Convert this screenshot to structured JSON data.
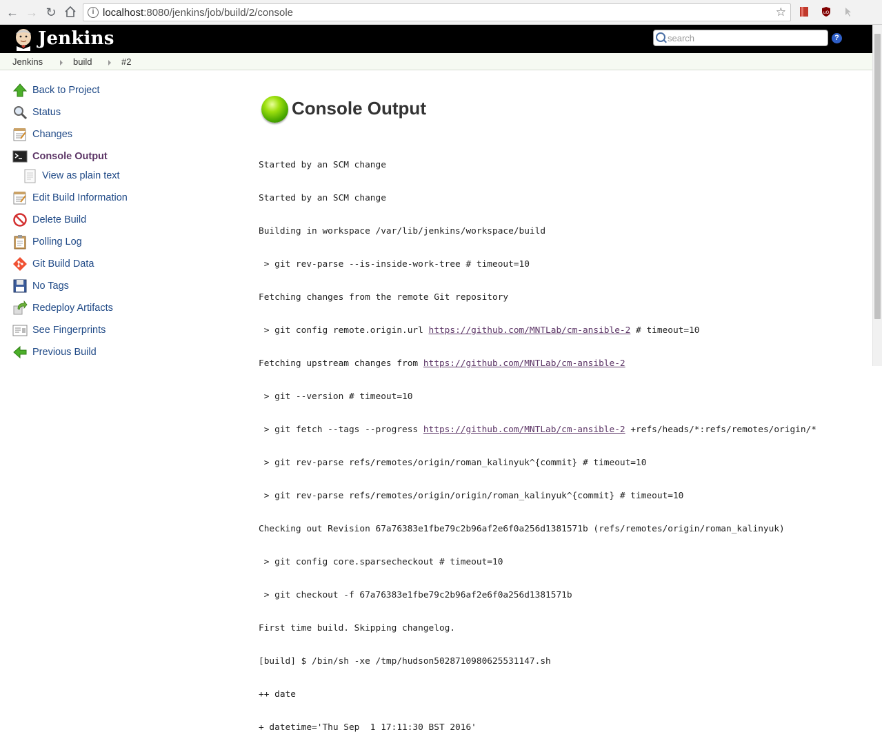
{
  "browser": {
    "url_host": "localhost",
    "url_path": ":8080/jenkins/job/build/2/console"
  },
  "header": {
    "logo_text": "Jenkins",
    "search_placeholder": "search"
  },
  "breadcrumb": [
    "Jenkins",
    "build",
    "#2"
  ],
  "sidebar": {
    "items": [
      {
        "label": "Back to Project",
        "icon": "up-arrow-icon"
      },
      {
        "label": "Status",
        "icon": "magnifier-icon"
      },
      {
        "label": "Changes",
        "icon": "notepad-icon"
      },
      {
        "label": "Console Output",
        "icon": "terminal-icon",
        "active": true
      },
      {
        "label": "View as plain text",
        "icon": "document-icon",
        "sub": true
      },
      {
        "label": "Edit Build Information",
        "icon": "notepad-icon"
      },
      {
        "label": "Delete Build",
        "icon": "no-entry-icon"
      },
      {
        "label": "Polling Log",
        "icon": "clipboard-icon"
      },
      {
        "label": "Git Build Data",
        "icon": "git-icon"
      },
      {
        "label": "No Tags",
        "icon": "save-disk-icon"
      },
      {
        "label": "Redeploy Artifacts",
        "icon": "redeploy-icon"
      },
      {
        "label": "See Fingerprints",
        "icon": "fingerprint-icon"
      },
      {
        "label": "Previous Build",
        "icon": "left-arrow-icon"
      }
    ]
  },
  "main": {
    "title": "Console Output",
    "status_color": "#7ac70c",
    "console_lines": [
      {
        "text": "Started by an SCM change"
      },
      {
        "text": "Started by an SCM change"
      },
      {
        "text": "Building in workspace /var/lib/jenkins/workspace/build"
      },
      {
        "text": " > git rev-parse --is-inside-work-tree # timeout=10"
      },
      {
        "text": "Fetching changes from the remote Git repository"
      },
      {
        "pre": " > git config remote.origin.url ",
        "link": "https://github.com/MNTLab/cm-ansible-2",
        "post": " # timeout=10"
      },
      {
        "pre": "Fetching upstream changes from ",
        "link": "https://github.com/MNTLab/cm-ansible-2",
        "post": ""
      },
      {
        "text": " > git --version # timeout=10"
      },
      {
        "pre": " > git fetch --tags --progress ",
        "link": "https://github.com/MNTLab/cm-ansible-2",
        "post": " +refs/heads/*:refs/remotes/origin/*"
      },
      {
        "text": " > git rev-parse refs/remotes/origin/roman_kalinyuk^{commit} # timeout=10"
      },
      {
        "text": " > git rev-parse refs/remotes/origin/origin/roman_kalinyuk^{commit} # timeout=10"
      },
      {
        "text": "Checking out Revision 67a76383e1fbe79c2b96af2e6f0a256d1381571b (refs/remotes/origin/roman_kalinyuk)"
      },
      {
        "text": " > git config core.sparsecheckout # timeout=10"
      },
      {
        "text": " > git checkout -f 67a76383e1fbe79c2b96af2e6f0a256d1381571b"
      },
      {
        "text": "First time build. Skipping changelog."
      },
      {
        "text": "[build] $ /bin/sh -xe /tmp/hudson5028710980625531147.sh"
      },
      {
        "text": "++ date"
      },
      {
        "text": "+ datetime='Thu Sep  1 17:11:30 BST 2016'"
      }
    ]
  }
}
